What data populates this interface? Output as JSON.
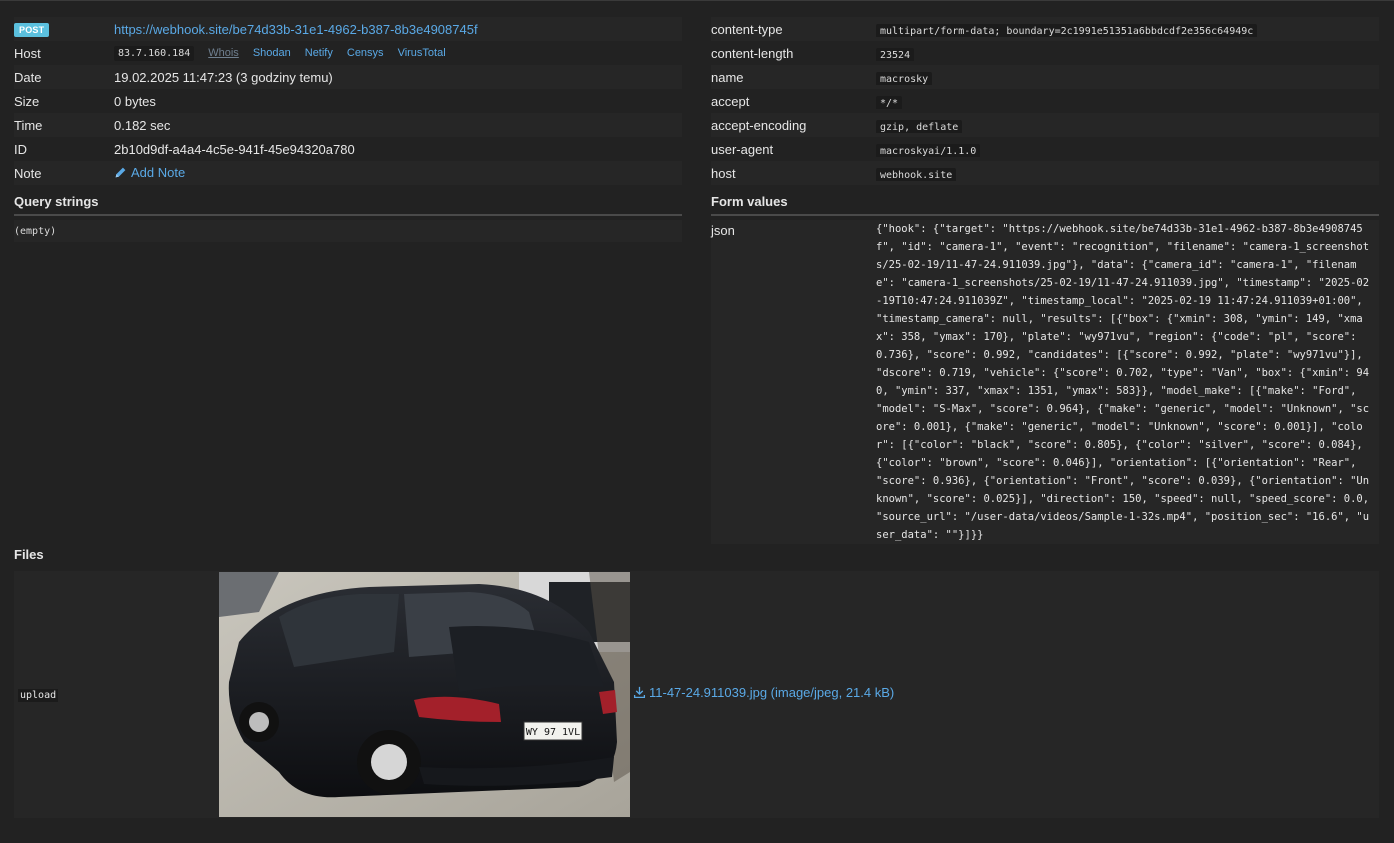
{
  "request": {
    "method": "POST",
    "url": "https://webhook.site/be74d33b-31e1-4962-b387-8b3e4908745f",
    "host_label": "Host",
    "host_ip": "83.7.160.184",
    "host_links": [
      "Whois",
      "Shodan",
      "Netify",
      "Censys",
      "VirusTotal"
    ],
    "date_label": "Date",
    "date": "19.02.2025 11:47:23 (3 godziny temu)",
    "size_label": "Size",
    "size": "0 bytes",
    "time_label": "Time",
    "time": "0.182 sec",
    "id_label": "ID",
    "id": "2b10d9df-a4a4-4c5e-941f-45e94320a780",
    "note_label": "Note",
    "add_note": "Add Note"
  },
  "query_strings": {
    "title": "Query strings",
    "empty": "(empty)"
  },
  "headers": [
    {
      "name": "content-type",
      "value": "multipart/form-data; boundary=2c1991e51351a6bbdcdf2e356c64949c"
    },
    {
      "name": "content-length",
      "value": "23524"
    },
    {
      "name": "name",
      "value": "macrosky"
    },
    {
      "name": "accept",
      "value": "*/*"
    },
    {
      "name": "accept-encoding",
      "value": "gzip, deflate"
    },
    {
      "name": "user-agent",
      "value": "macroskyai/1.1.0"
    },
    {
      "name": "host",
      "value": "webhook.site"
    }
  ],
  "form_values": {
    "title": "Form values",
    "key": "json",
    "value": "{\"hook\": {\"target\": \"https://webhook.site/be74d33b-31e1-4962-b387-8b3e4908745f\", \"id\": \"camera-1\", \"event\": \"recognition\", \"filename\": \"camera-1_screenshots/25-02-19/11-47-24.911039.jpg\"}, \"data\": {\"camera_id\": \"camera-1\", \"filename\": \"camera-1_screenshots/25-02-19/11-47-24.911039.jpg\", \"timestamp\": \"2025-02-19T10:47:24.911039Z\", \"timestamp_local\": \"2025-02-19 11:47:24.911039+01:00\", \"timestamp_camera\": null, \"results\": [{\"box\": {\"xmin\": 308, \"ymin\": 149, \"xmax\": 358, \"ymax\": 170}, \"plate\": \"wy971vu\", \"region\": {\"code\": \"pl\", \"score\": 0.736}, \"score\": 0.992, \"candidates\": [{\"score\": 0.992, \"plate\": \"wy971vu\"}], \"dscore\": 0.719, \"vehicle\": {\"score\": 0.702, \"type\": \"Van\", \"box\": {\"xmin\": 940, \"ymin\": 337, \"xmax\": 1351, \"ymax\": 583}}, \"model_make\": [{\"make\": \"Ford\", \"model\": \"S-Max\", \"score\": 0.964}, {\"make\": \"generic\", \"model\": \"Unknown\", \"score\": 0.001}, {\"make\": \"generic\", \"model\": \"Unknown\", \"score\": 0.001}], \"color\": [{\"color\": \"black\", \"score\": 0.805}, {\"color\": \"silver\", \"score\": 0.084}, {\"color\": \"brown\", \"score\": 0.046}], \"orientation\": [{\"orientation\": \"Rear\", \"score\": 0.936}, {\"orientation\": \"Front\", \"score\": 0.039}, {\"orientation\": \"Unknown\", \"score\": 0.025}], \"direction\": 150, \"speed\": null, \"speed_score\": 0.0, \"source_url\": \"/user-data/videos/Sample-1-32s.mp4\", \"position_sec\": \"16.6\", \"user_data\": \"\"}]}}"
  },
  "files": {
    "title": "Files",
    "key": "upload",
    "plate_text": "WY 97 1VL",
    "link": "11-47-24.911039.jpg (image/jpeg, 21.4 kB)"
  },
  "colors": {
    "background": "#222222",
    "link": "#5aa9e6",
    "badge": "#5bc0de"
  }
}
